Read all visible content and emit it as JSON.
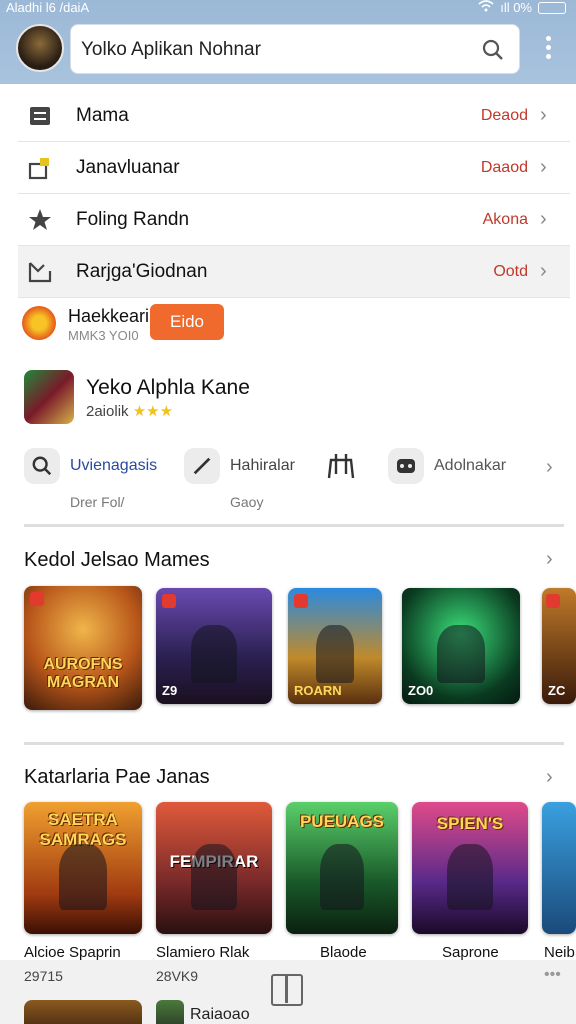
{
  "status_bar": {
    "left_text": "Aladhi l6 /daiA",
    "right_text": "ıll 0%"
  },
  "search": {
    "value": "Yolko Aplikan Nohnar"
  },
  "menu_rows": [
    {
      "label": "Mama",
      "status": "Deaod"
    },
    {
      "label": "Janavluanar",
      "status": "Daaod"
    },
    {
      "label": "Foling Randn",
      "status": "Akona"
    },
    {
      "label": "Rarjga'Giodnan",
      "status": "Ootd"
    }
  ],
  "app_entry_1": {
    "title": "Haekkeari",
    "subtitle": "MMK3 YOI0",
    "button": "Eido"
  },
  "app_entry_2": {
    "title": "Yeko Alphla Kane",
    "rating_text": "2aiolik",
    "stars": "★★★"
  },
  "quick_actions": [
    {
      "label": "Uvienagasis",
      "sub": "Drer Fol/"
    },
    {
      "label": "Hahiralar",
      "sub": "Gaoy"
    },
    {
      "label": "",
      "sub": ""
    },
    {
      "label": "Adolnakar",
      "sub": ""
    }
  ],
  "section_1": {
    "title": "Kedol Jelsao Mames",
    "tiles": [
      {
        "text": "AUROFNS MAGRAN",
        "badge": ""
      },
      {
        "text": "",
        "badge": "Z9"
      },
      {
        "text": "",
        "badge": "ROARN"
      },
      {
        "text": "",
        "badge": "ZO0"
      },
      {
        "text": "",
        "badge": "ZC"
      }
    ]
  },
  "section_2": {
    "title": "Katarlaria Pae Janas",
    "tiles": [
      {
        "text": "SAETRA SAMRAGS",
        "name": "Alcioe Spaprin",
        "sub": "29715"
      },
      {
        "text": "FEMPIRAR",
        "name": "Slamiero Rlak",
        "sub": "28VK9"
      },
      {
        "text": "PUEUAGS",
        "name": "Blaode",
        "sub": ""
      },
      {
        "text": "SPIEN'S",
        "name": "Saprone",
        "sub": ""
      },
      {
        "text": "",
        "name": "Neib",
        "sub": ""
      }
    ]
  },
  "bottom": {
    "peek_label": "Raiaoao"
  },
  "colors": {
    "header": "#a9c3de",
    "status_red": "#c0392b",
    "accent_orange": "#ef6a2c",
    "stars": "#f4c21a"
  }
}
